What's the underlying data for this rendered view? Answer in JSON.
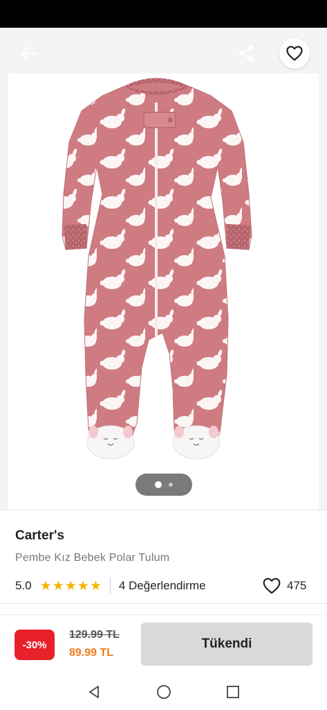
{
  "product": {
    "brand": "Carter's",
    "name": "Pembe Kız Bebek Polar Tulum",
    "rating": "5.0",
    "stars": [
      "★",
      "★",
      "★",
      "★",
      "★"
    ],
    "review_label": "4 Değerlendirme",
    "favorite_count": "475",
    "image_pager": {
      "total": 2,
      "active": 1
    }
  },
  "purchase": {
    "discount": "-30%",
    "old_price": "129.99 TL",
    "new_price": "89.99 TL",
    "action_label": "Tükendi"
  },
  "icons": {
    "back": "arrow-left-icon",
    "share": "share-icon",
    "favorite": "heart-outline-icon",
    "nav_back": "triangle-back-icon",
    "nav_home": "circle-home-icon",
    "nav_recents": "square-recents-icon"
  },
  "colors": {
    "discount_badge": "#e8202a",
    "new_price": "#f27a1a",
    "star": "#f5b400",
    "sold_out_button": "#d9d9d9",
    "onesie_pink": "#cf7b82"
  }
}
